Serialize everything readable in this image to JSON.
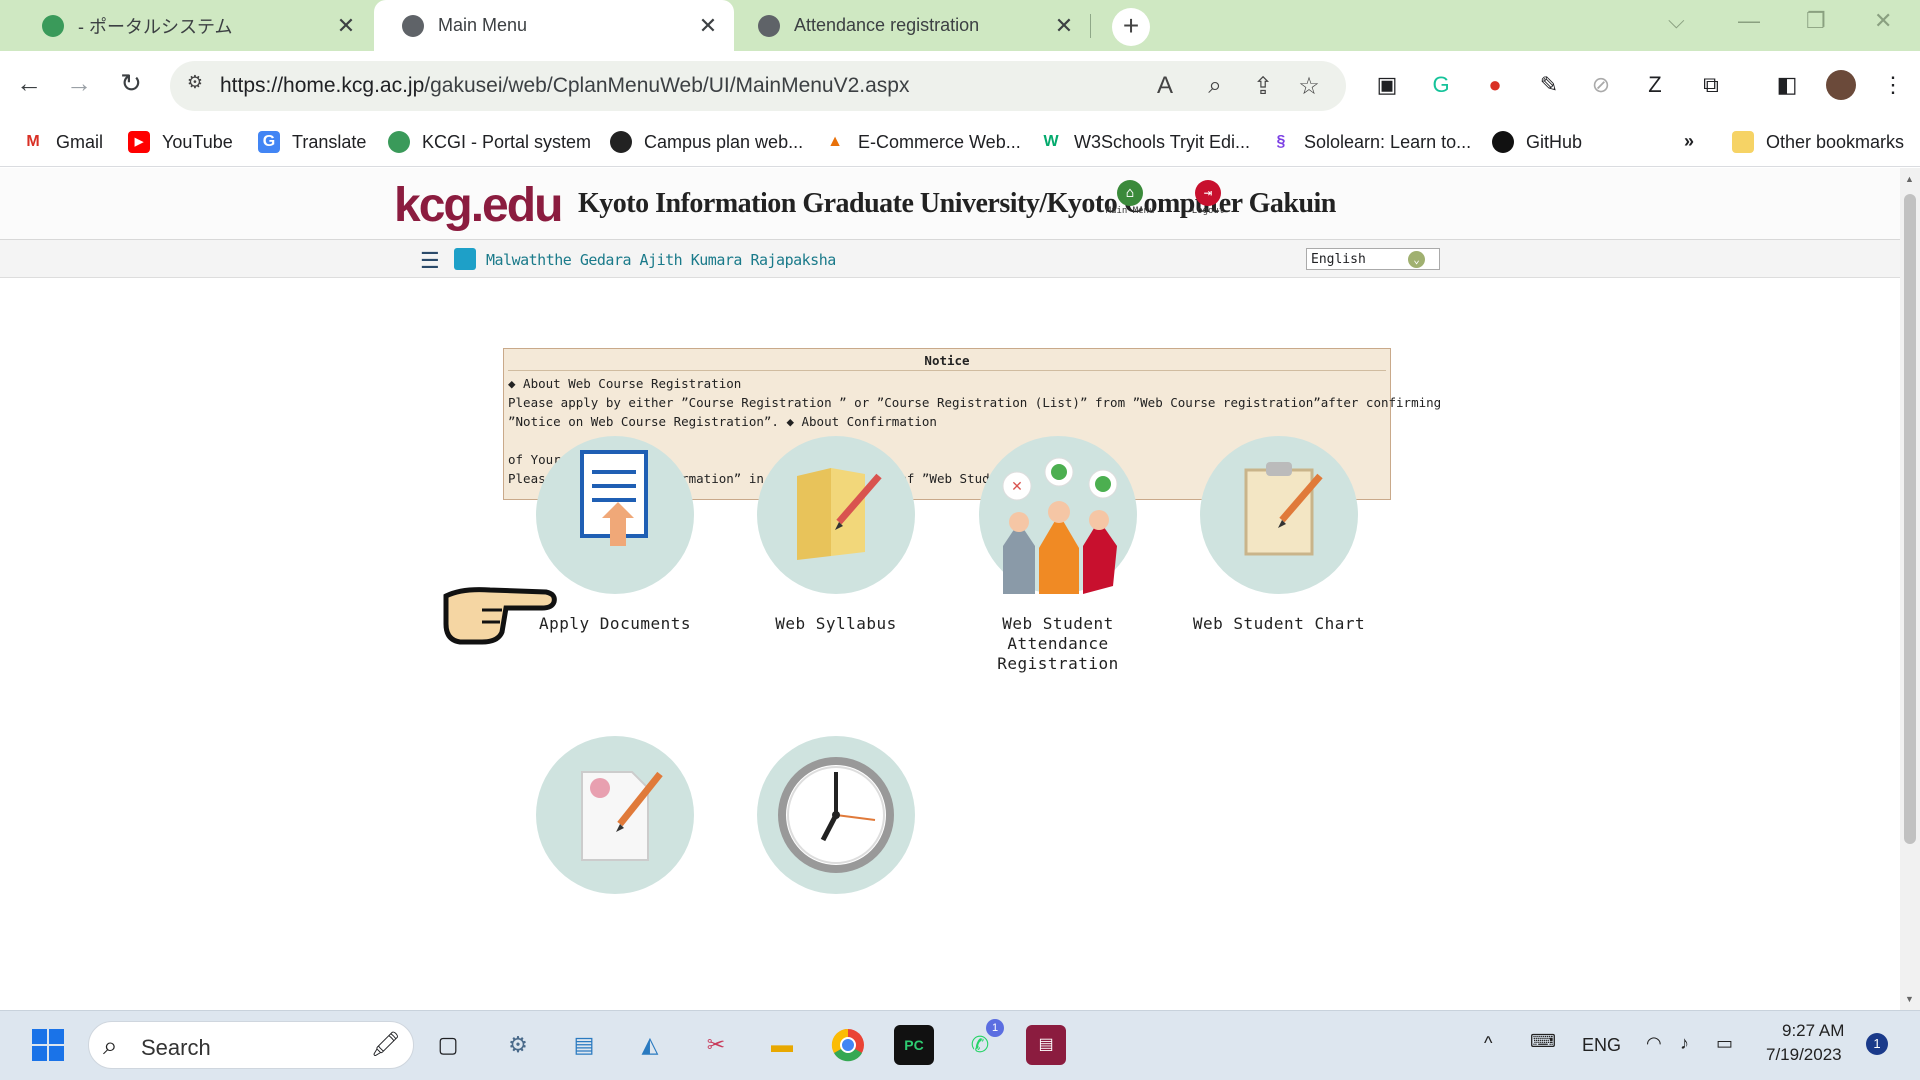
{
  "browser": {
    "tabs": [
      {
        "title": " - ポータルシステム",
        "active": false
      },
      {
        "title": "Main Menu",
        "active": true
      },
      {
        "title": "Attendance registration",
        "active": false
      }
    ],
    "new_tab": "+",
    "url_host": "https://home.kcg.ac.jp",
    "url_path": "/gakusei/web/CplanMenuWeb/UI/MainMenuV2.aspx",
    "bookmarks": [
      {
        "label": "Gmail",
        "icon": "gmail-icon",
        "color": "#d93025"
      },
      {
        "label": "YouTube",
        "icon": "youtube-icon",
        "color": "#ff0000"
      },
      {
        "label": "Translate",
        "icon": "translate-icon",
        "color": "#4285f4"
      },
      {
        "label": "KCGI - Portal system",
        "icon": "kcgi-icon",
        "color": "#2e8b57"
      },
      {
        "label": "Campus plan web...",
        "icon": "globe-icon",
        "color": "#222222"
      },
      {
        "label": "E-Commerce Web...",
        "icon": "ecommerce-icon",
        "color": "#e8710a"
      },
      {
        "label": "W3Schools Tryit Edi...",
        "icon": "w3schools-icon",
        "color": "#04aa6d"
      },
      {
        "label": "Sololearn: Learn to...",
        "icon": "sololearn-icon",
        "color": "#7b3fe4"
      },
      {
        "label": "GitHub",
        "icon": "github-icon",
        "color": "#111111"
      }
    ],
    "more_bookmarks": "»",
    "other_bookmarks": "Other bookmarks"
  },
  "site": {
    "logo": "kcg.edu",
    "university_name": "Kyoto Information Graduate University/Kyoto Computer Gakuin",
    "main_menu_label": "Main Menu",
    "logout_label": "Logout",
    "user_name": "Malwaththe Gedara Ajith Kumara Rajapaksha",
    "language": "English",
    "accent_color": "#8b1c3f"
  },
  "notice": {
    "title": "Notice",
    "lines": [
      "◆ About Web Course Registration",
      "Please apply by either ”Course Registration ” or ”Course Registration (List)” from ”Web Course registration”after confirming",
      "”Notice on Web Course Registration”. ◆ About Confirmation",
      "",
      "of Your Grade",
      "Please check”Grade Information” in the right column of ”Web Student Chart”."
    ]
  },
  "menu": [
    {
      "label": "Apply Documents",
      "icon": "document-upload-icon"
    },
    {
      "label": "Web Syllabus",
      "icon": "folder-pencil-icon"
    },
    {
      "label": "Web Student Attendance Registration",
      "icon": "raised-hands-icon"
    },
    {
      "label": "Web Student Chart",
      "icon": "clipboard-pencil-icon"
    },
    {
      "label": "",
      "icon": "profile-document-icon"
    },
    {
      "label": "",
      "icon": "clock-icon"
    }
  ],
  "taskbar": {
    "search_placeholder": "Search",
    "language": "ENG",
    "time": "9:27 AM",
    "date": "7/19/2023",
    "notification_count": "1",
    "whatsapp_badge": "1"
  }
}
